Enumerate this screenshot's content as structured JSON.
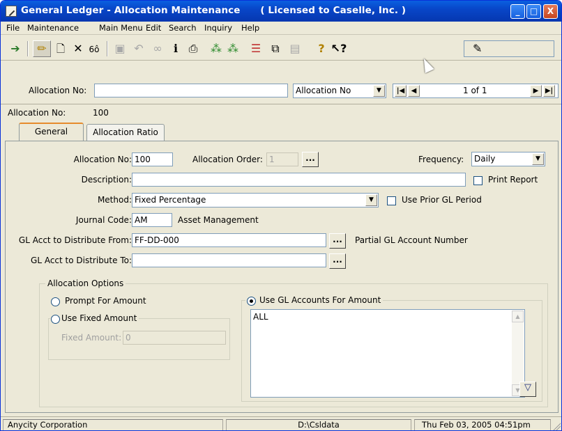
{
  "window": {
    "title": "General Ledger - Allocation Maintenance      ( Licensed to Caselle, Inc. )",
    "controls": {
      "minimize": "_",
      "maximize": "□",
      "close": "X"
    }
  },
  "menu": [
    "File",
    "Maintenance",
    "Main Menu",
    "Edit",
    "Search",
    "Inquiry",
    "Help"
  ],
  "toolbar": {
    "icons": [
      "exit-icon",
      "edit-pencil-icon",
      "new-record-icon",
      "delete-icon",
      "view-glasses-icon",
      "save-icon",
      "undo-icon",
      "find-binoculars-icon",
      "info-icon",
      "print-icon",
      "previous-record-icon",
      "next-record-icon",
      "notes-icon",
      "copy-icon",
      "memo-icon",
      "help-icon",
      "context-help-icon"
    ],
    "status_pencil": "✎"
  },
  "search": {
    "label": "Allocation No:",
    "value": "",
    "field_select": "Allocation No",
    "position": "1 of 1"
  },
  "record": {
    "label": "Allocation No:",
    "value": "100"
  },
  "tabs": [
    {
      "label": "General",
      "active": true
    },
    {
      "label": "Allocation Ratio",
      "active": false
    }
  ],
  "form": {
    "allocation_no_label": "Allocation No:",
    "allocation_no": "100",
    "allocation_order_label": "Allocation Order:",
    "allocation_order": "1",
    "frequency_label": "Frequency:",
    "frequency": "Daily",
    "description_label": "Description:",
    "description": "",
    "print_report_label": "Print Report",
    "method_label": "Method:",
    "method": "Fixed Percentage",
    "use_prior_label": "Use Prior GL Period",
    "journal_code_label": "Journal Code:",
    "journal_code": "AM",
    "journal_desc": "Asset Management",
    "dist_from_label": "GL Acct to Distribute From:",
    "dist_from": "FF-DD-000",
    "partial_note": "Partial GL Account Number",
    "dist_to_label": "GL Acct to Distribute To:",
    "dist_to": "",
    "ellipsis": "..."
  },
  "options": {
    "group_label": "Allocation Options",
    "prompt_amount": "Prompt For Amount",
    "use_fixed": "Use Fixed Amount",
    "fixed_amount_label": "Fixed Amount:",
    "fixed_amount": "0",
    "use_gl_accounts": "Use GL Accounts For Amount",
    "gl_accounts": [
      "ALL"
    ]
  },
  "status": {
    "company": "Anycity Corporation",
    "path": "D:\\Csldata",
    "datetime": "Thu Feb 03, 2005  04:51pm"
  }
}
